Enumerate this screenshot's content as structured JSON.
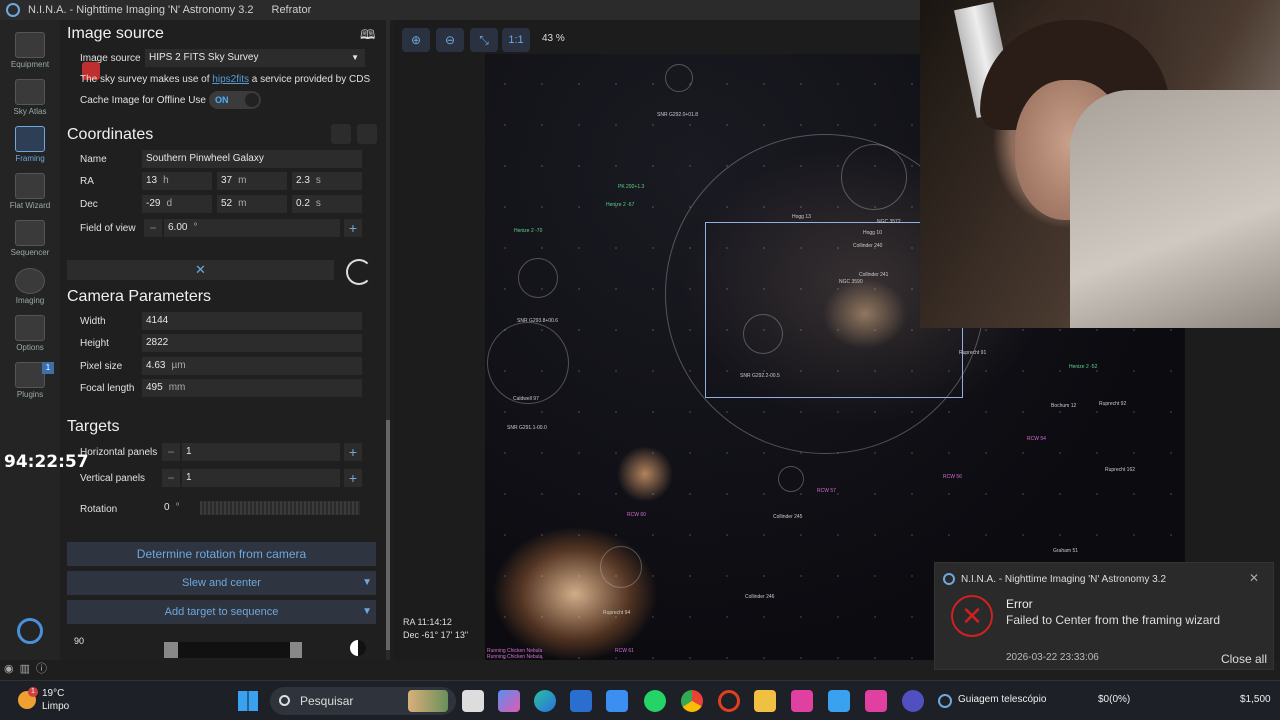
{
  "window": {
    "title": "N.I.N.A. - Nighttime Imaging 'N' Astronomy 3.2",
    "profile": "Refrator"
  },
  "sidebar": {
    "items": [
      {
        "label": "Equipment"
      },
      {
        "label": "Sky Atlas"
      },
      {
        "label": "Framing"
      },
      {
        "label": "Flat Wizard"
      },
      {
        "label": "Sequencer"
      },
      {
        "label": "Imaging"
      },
      {
        "label": "Options"
      },
      {
        "label": "Plugins",
        "badge": "1"
      }
    ],
    "collapse": "<<"
  },
  "image_source": {
    "title": "Image source",
    "label": "Image source",
    "value": "HIPS 2 FITS Sky Survey",
    "note_pre": "The sky survey makes use of",
    "note_link": "hips2fits",
    "note_post": "a service provided by CDS",
    "cache_label": "Cache Image for Offline Use",
    "cache_state": "ON"
  },
  "coordinates": {
    "title": "Coordinates",
    "name_label": "Name",
    "name_value": "Southern Pinwheel Galaxy",
    "ra_label": "RA",
    "ra_h": "13",
    "ra_h_unit": "h",
    "ra_m": "37",
    "ra_m_unit": "m",
    "ra_s": "2.3",
    "ra_s_unit": "s",
    "dec_label": "Dec",
    "dec_d": "-29",
    "dec_d_unit": "d",
    "dec_m": "52",
    "dec_m_unit": "m",
    "dec_s": "0.2",
    "dec_s_unit": "s",
    "fov_label": "Field of view",
    "fov_value": "6.00",
    "fov_unit": "°"
  },
  "camera": {
    "title": "Camera Parameters",
    "width_label": "Width",
    "width_value": "4144",
    "height_label": "Height",
    "height_value": "2822",
    "pixel_label": "Pixel size",
    "pixel_value": "4.63",
    "pixel_unit": "µm",
    "focal_label": "Focal length",
    "focal_value": "495",
    "focal_unit": "mm"
  },
  "targets": {
    "title": "Targets",
    "hpanels_label": "Horizontal panels",
    "hpanels_value": "1",
    "vpanels_label": "Vertical panels",
    "vpanels_value": "1",
    "rotation_label": "Rotation",
    "rotation_value": "0",
    "rotation_unit": "°"
  },
  "buttons": {
    "determine_rotation": "Determine rotation from camera",
    "slew_center": "Slew and center",
    "add_target": "Add target to sequence"
  },
  "bottom_slider_value": "90",
  "timer": "94:22:57",
  "viewer": {
    "zoom_1to1": "1:1",
    "zoom_level": "43 %",
    "ra_readout": "RA 11:14:12",
    "dec_readout": "Dec -61° 17' 13\"",
    "labels": [
      "SNR G292.0+01.8",
      "PK 292+1.3",
      "Henize 2 -67",
      "Henize 2 -70",
      "Hogg 13",
      "NGC 3572",
      "Hogg 10",
      "Collinder 240",
      "Collinder 241",
      "NGC 3590",
      "SNR G293.8+00.6",
      "SNR G292.2-00.5",
      "Caldwell 97",
      "SNR G291.1-00.0",
      "Henize 2 -52",
      "Bochum 12",
      "Ruprecht 92",
      "RCW 54",
      "RCW 57",
      "RCW 56",
      "Collinder 245",
      "Ruprecht 162",
      "RCW 60",
      "Graham 51",
      "Collinder 246",
      "Ruprecht 94",
      "RCW 61",
      "Running Chicken Nebula",
      "Running Chicken Nebula",
      "Ruprecht 91"
    ]
  },
  "toast": {
    "app": "N.I.N.A. - Nighttime Imaging 'N' Astronomy 3.2",
    "title": "Error",
    "message": "Failed to Center from the framing wizard",
    "timestamp": "2026-03-22 23:33:06",
    "close_all": "Close all"
  },
  "taskbar": {
    "temp": "19°C",
    "condition": "Limpo",
    "weather_badge": "1",
    "search": "Pesquisar",
    "guiding": "Guiagem telescópio",
    "stock1": "$0(0%)",
    "stock2": "$1,500"
  },
  "colors": {
    "accent": "#6fa8dc",
    "error": "#d02020",
    "panel_bg": "#1f1f1f"
  }
}
